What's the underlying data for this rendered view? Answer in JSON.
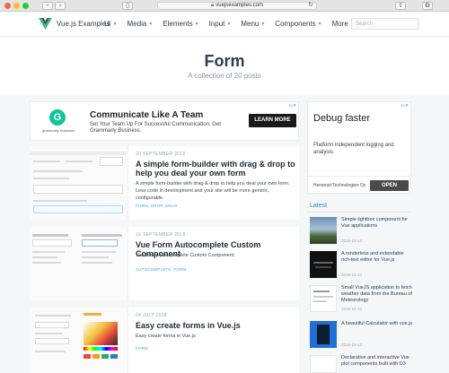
{
  "browser": {
    "url": "vuejsexamples.com",
    "icons": [
      "back-icon",
      "forward-icon",
      "sidebar-icon",
      "reload-icon",
      "share-icon",
      "tabs-icon"
    ]
  },
  "site": {
    "brand": "Vue.js Examples",
    "nav": [
      {
        "label": "Ui",
        "dropdown": true
      },
      {
        "label": "Media",
        "dropdown": true
      },
      {
        "label": "Elements",
        "dropdown": true
      },
      {
        "label": "Input",
        "dropdown": true
      },
      {
        "label": "Menu",
        "dropdown": true
      },
      {
        "label": "Components",
        "dropdown": true
      },
      {
        "label": "More",
        "dropdown": true
      }
    ],
    "search_placeholder": "Search",
    "colors": {
      "vue_green": "#41b883",
      "vue_dark": "#35495e",
      "link": "#42a5d8"
    }
  },
  "header": {
    "title": "Form",
    "subtitle": "A collection of 20 posts"
  },
  "top_ad": {
    "brand": "grammarly business",
    "title": "Communicate Like A Team",
    "text": "Set Your Team Up For Successful Communication. Get Grammarly Business.",
    "cta": "LEARN MORE"
  },
  "side_ad": {
    "title": "Debug faster",
    "text": "Platform independent logging and analysis.",
    "brand": "Herwood Technologies Oy",
    "cta": "OPEN"
  },
  "posts": [
    {
      "date": "20 SEPTEMBER 2018",
      "title": "A simple form-builder with drag & drop to help you deal your own form",
      "desc": "A simple form-builder with drag & drop to help you deal your own form. Less code in development and your site will be more generic, configurable.",
      "tags": "FORM, DROP, DRAG"
    },
    {
      "date": "19 SEPTEMBER 2018",
      "title": "Vue Form Autocomplete Custom Component",
      "desc": "Vue Form Autocomplete Custom Component.",
      "tags": "AUTOCOMPLETE, FORM"
    },
    {
      "date": "04 JULY 2018",
      "title": "Easy create forms in Vue.js",
      "desc": "Easy create forms in Vue.js",
      "tags": "FORM"
    }
  ],
  "latest": {
    "heading": "Latest",
    "items": [
      {
        "title": "Simple lightbox component for Vue applications",
        "date": "2018-10-14"
      },
      {
        "title": "A renderless and extendable rich-text editor for Vue.js",
        "date": "2018-10-13"
      },
      {
        "title": "Small VueJS application to fetch weather data from the Bureau of Meteorology",
        "date": "2018-10-13"
      },
      {
        "title": "A beautiful Calculator with vue.js",
        "date": "2018-10-13"
      },
      {
        "title": "Declarative and interactive Vue plot components built with D3",
        "date": ""
      }
    ]
  }
}
